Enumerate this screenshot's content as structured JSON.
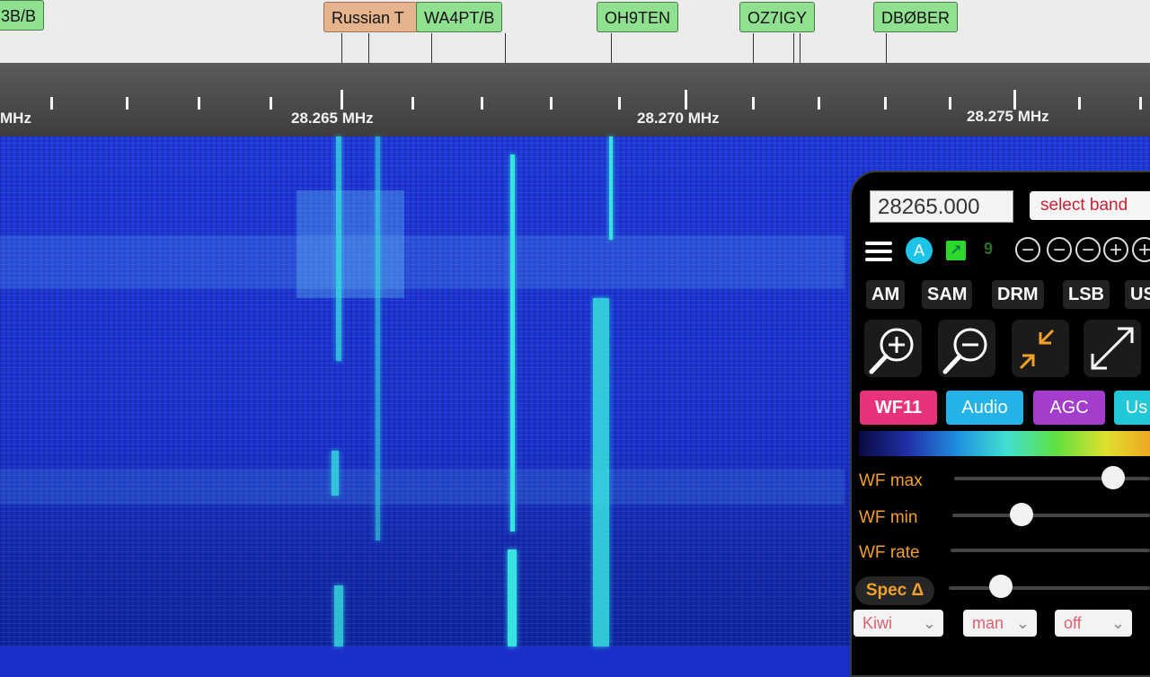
{
  "labels": [
    {
      "text": "3B/B",
      "color": "green"
    },
    {
      "text": "Russian T",
      "color": "tan"
    },
    {
      "text": "WA4PT/B",
      "color": "green"
    },
    {
      "text": "OH9TEN",
      "color": "green"
    },
    {
      "text": "OZ7IGY",
      "color": "green"
    },
    {
      "text": "DBØBER",
      "color": "green"
    }
  ],
  "scale": {
    "freq_left": "MHz",
    "freq_1": "28.265 MHz",
    "freq_2": "28.270 MHz",
    "freq_3": "28.275 MHz"
  },
  "panel": {
    "frequency_value": "28265.000",
    "select_band": "select band",
    "a_label": "A",
    "nine_label": "9",
    "modes": [
      "AM",
      "SAM",
      "DRM",
      "LSB",
      "US"
    ],
    "tabs": {
      "wf": "WF11",
      "audio": "Audio",
      "agc": "AGC",
      "user": "Us"
    },
    "sliders": {
      "wf_max": "WF max",
      "wf_min": "WF min",
      "wf_rate": "WF rate"
    },
    "spec_label": "Spec Δ",
    "selects": {
      "kiwi": "Kiwi",
      "man": "man",
      "off": "off"
    }
  },
  "colors": {
    "label_green": "#8fe08f",
    "label_tan": "#e6b48c",
    "passband": "#22d622",
    "waterfall": "#1c33cc",
    "signal": "#36e3e0",
    "wf_tab": "#e8327c",
    "audio_tab": "#23b3e6",
    "agc_tab": "#a43ccc",
    "slider_label": "#f3a02a"
  }
}
